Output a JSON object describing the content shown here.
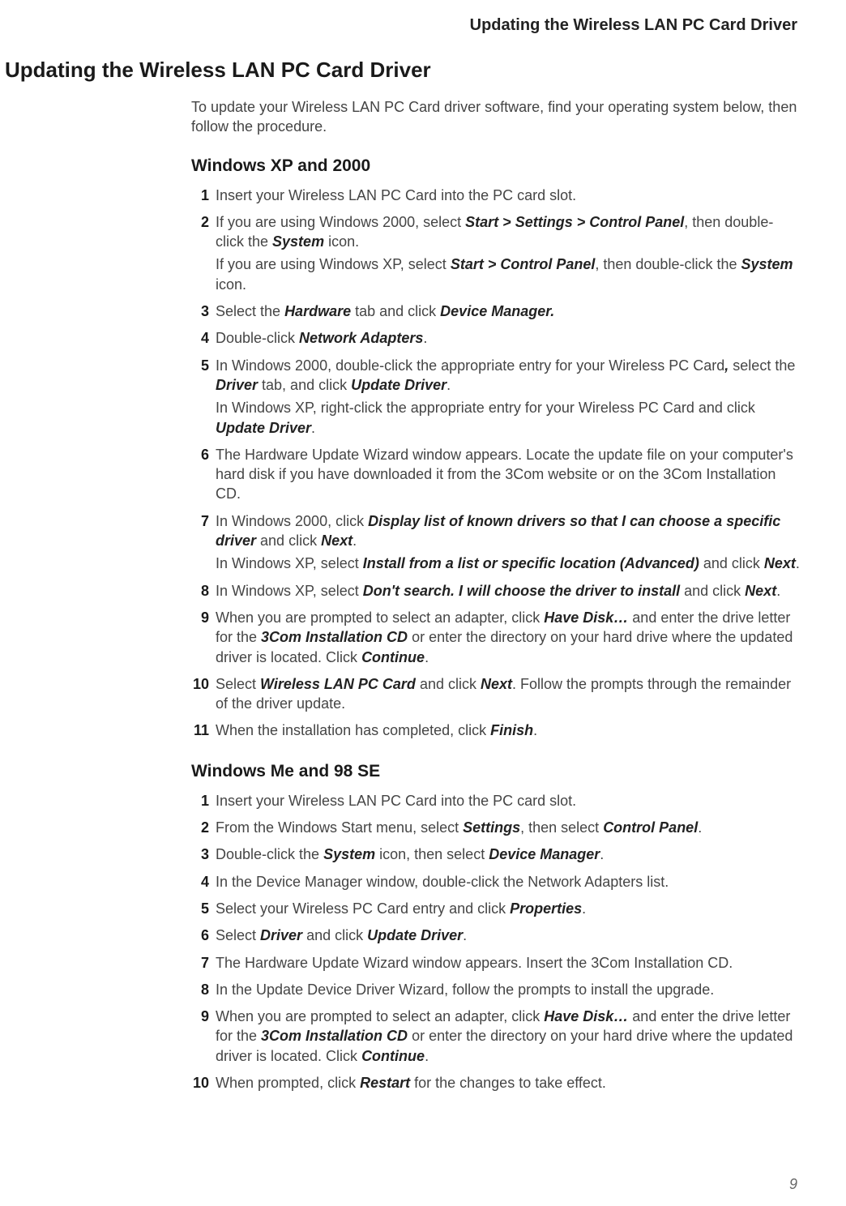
{
  "header": "Updating the Wireless LAN PC Card Driver",
  "main_heading": "Updating the Wireless LAN PC Card Driver",
  "intro": "To update your Wireless LAN PC Card driver software, find your operating system below, then follow the procedure.",
  "page_number": "9",
  "sections": [
    {
      "heading": "Windows XP and 2000",
      "steps": [
        [
          {
            "t": "Insert your Wireless LAN PC Card into the PC card slot."
          }
        ],
        [
          {
            "t": "If you are using Windows 2000, select "
          },
          {
            "t": "Start > Settings > Control Panel",
            "s": "bi"
          },
          {
            "t": ", then double-click the "
          },
          {
            "t": "System",
            "s": "bi"
          },
          {
            "t": " icon."
          },
          {
            "br": true
          },
          {
            "t": "If you are using Windows XP, select "
          },
          {
            "t": "Start > Control Panel",
            "s": "bi"
          },
          {
            "t": ", then double-click the "
          },
          {
            "t": "System",
            "s": "bi"
          },
          {
            "t": " icon."
          }
        ],
        [
          {
            "t": "Select the "
          },
          {
            "t": "Hardware",
            "s": "bi"
          },
          {
            "t": " tab and click "
          },
          {
            "t": "Device Manager.",
            "s": "bi"
          }
        ],
        [
          {
            "t": "Double-click "
          },
          {
            "t": "Network Adapters",
            "s": "bi"
          },
          {
            "t": "."
          }
        ],
        [
          {
            "t": "In Windows 2000, double-click the appropriate entry for your Wireless PC Card"
          },
          {
            "t": ",",
            "s": "bi"
          },
          {
            "t": " select the "
          },
          {
            "t": "Driver",
            "s": "bi"
          },
          {
            "t": " tab, and click "
          },
          {
            "t": "Update Driver",
            "s": "bi"
          },
          {
            "t": "."
          },
          {
            "br": true
          },
          {
            "t": "In Windows XP, right-click the appropriate entry for your Wireless PC Card and click "
          },
          {
            "t": "Update Driver",
            "s": "bi"
          },
          {
            "t": "."
          }
        ],
        [
          {
            "t": "The Hardware Update Wizard window appears. Locate the update file on your computer's hard disk if you have downloaded it from the 3Com website or on the 3Com Installation CD."
          }
        ],
        [
          {
            "t": "In Windows 2000, click "
          },
          {
            "t": "Display list of known drivers so that I can choose a specific driver",
            "s": "bi"
          },
          {
            "t": " and click "
          },
          {
            "t": "Next",
            "s": "bi"
          },
          {
            "t": "."
          },
          {
            "br": true
          },
          {
            "t": "In Windows XP, select "
          },
          {
            "t": "Install from a list or specific location (Advanced)",
            "s": "bi"
          },
          {
            "t": " and click "
          },
          {
            "t": "Next",
            "s": "bi"
          },
          {
            "t": "."
          }
        ],
        [
          {
            "t": "In Windows XP, select "
          },
          {
            "t": "Don't search. I will choose the driver to install",
            "s": "bi"
          },
          {
            "t": " and click "
          },
          {
            "t": "Next",
            "s": "bi"
          },
          {
            "t": "."
          }
        ],
        [
          {
            "t": "When you are prompted to select an adapter, click "
          },
          {
            "t": "Have Disk…",
            "s": "bi"
          },
          {
            "t": " and enter the drive letter for the "
          },
          {
            "t": "3Com Installation CD",
            "s": "bi"
          },
          {
            "t": " or enter the directory on your hard drive where the updated driver is located. Click "
          },
          {
            "t": "Continue",
            "s": "bi"
          },
          {
            "t": "."
          }
        ],
        [
          {
            "t": "Select "
          },
          {
            "t": "Wireless LAN PC Card",
            "s": "bi"
          },
          {
            "t": " and click "
          },
          {
            "t": "Next",
            "s": "bi"
          },
          {
            "t": ". Follow the prompts through the remainder of the driver update."
          }
        ],
        [
          {
            "t": "When the installation has completed, click "
          },
          {
            "t": "Finish",
            "s": "bi"
          },
          {
            "t": "."
          }
        ]
      ]
    },
    {
      "heading": "Windows Me and 98 SE",
      "steps": [
        [
          {
            "t": "Insert your Wireless LAN PC Card into the PC card slot."
          }
        ],
        [
          {
            "t": "From the Windows Start menu, select "
          },
          {
            "t": "Settings",
            "s": "bi"
          },
          {
            "t": ", then select "
          },
          {
            "t": "Control Panel",
            "s": "bi"
          },
          {
            "t": "."
          }
        ],
        [
          {
            "t": "Double-click the "
          },
          {
            "t": "System",
            "s": "bi"
          },
          {
            "t": " icon, then select "
          },
          {
            "t": "Device Manager",
            "s": "bi"
          },
          {
            "t": "."
          }
        ],
        [
          {
            "t": "In the Device Manager window, double-click the Network Adapters list."
          }
        ],
        [
          {
            "t": "Select your Wireless PC Card entry and click "
          },
          {
            "t": "Properties",
            "s": "bi"
          },
          {
            "t": "."
          }
        ],
        [
          {
            "t": "Select "
          },
          {
            "t": "Driver",
            "s": "bi"
          },
          {
            "t": " and click "
          },
          {
            "t": "Update Driver",
            "s": "bi"
          },
          {
            "t": "."
          }
        ],
        [
          {
            "t": "The Hardware Update Wizard window appears. Insert the 3Com Installation CD."
          }
        ],
        [
          {
            "t": "In the Update Device Driver Wizard, follow the prompts to install the upgrade."
          }
        ],
        [
          {
            "t": "When you are prompted to select an adapter, click "
          },
          {
            "t": "Have Disk…",
            "s": "bi"
          },
          {
            "t": " and enter the drive letter for the "
          },
          {
            "t": "3Com Installation CD",
            "s": "bi"
          },
          {
            "t": " or enter the directory on your hard drive where the updated driver is located. Click "
          },
          {
            "t": "Continue",
            "s": "bi"
          },
          {
            "t": "."
          }
        ],
        [
          {
            "t": "When prompted, click "
          },
          {
            "t": "Restart",
            "s": "bi"
          },
          {
            "t": " for the changes to take effect."
          }
        ]
      ]
    }
  ]
}
